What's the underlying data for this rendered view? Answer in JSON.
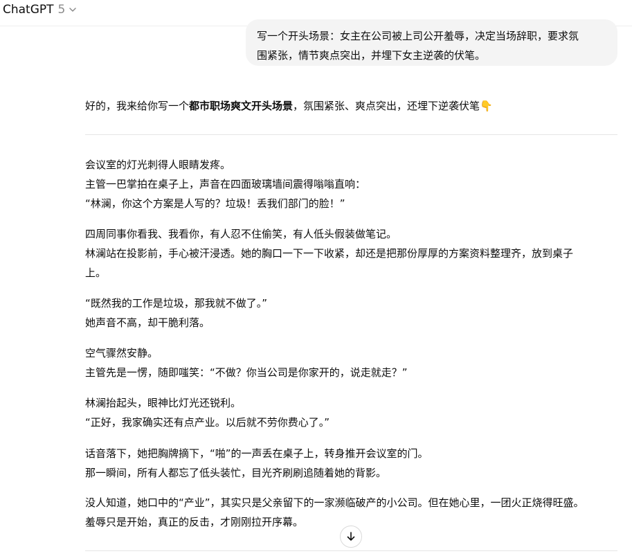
{
  "header": {
    "model_name": "ChatGPT",
    "model_version": "5"
  },
  "user_message": {
    "line1": "写一个开头场景：女主在公司被上司公开羞辱，决定当场辞职，要求氛",
    "line2": "围紧张，情节爽点突出，并埋下女主逆袭的伏笔。"
  },
  "assistant": {
    "intro_prefix": "好的，我来给你写一个",
    "intro_bold": "都市职场爽文开头场景",
    "intro_suffix": "，氛围紧张、爽点突出，还埋下逆袭伏笔👇",
    "paragraphs": [
      [
        "会议室的灯光刺得人眼睛发疼。",
        "主管一巴掌拍在桌子上，声音在四面玻璃墙间震得嗡嗡直响：",
        "“林澜，你这个方案是人写的？垃圾！丢我们部门的脸！”"
      ],
      [
        "四周同事你看我、我看你，有人忍不住偷笑，有人低头假装做笔记。",
        "林澜站在投影前，手心被汗浸透。她的胸口一下一下收紧，却还是把那份厚厚的方案资料整理齐，放到桌子",
        "上。"
      ],
      [
        "“既然我的工作是垃圾，那我就不做了。”",
        "她声音不高，却干脆利落。"
      ],
      [
        "空气骤然安静。",
        "主管先是一愣，随即嗤笑：“不做？你当公司是你家开的，说走就走？”"
      ],
      [
        "林澜抬起头，眼神比灯光还锐利。",
        "“正好，我家确实还有点产业。以后就不劳你费心了。”"
      ],
      [
        "话音落下，她把胸牌摘下，“啪”的一声丢在桌子上，转身推开会议室的门。",
        "那一瞬间，所有人都忘了低头装忙，目光齐刷刷追随着她的背影。"
      ],
      [
        "没人知道，她口中的“产业”，其实只是父亲留下的一家濒临破产的小公司。但在她心里，一团火正烧得旺盛。",
        "羞辱只是开始，真正的反击，才刚刚拉开序幕。"
      ]
    ]
  },
  "icons": {
    "model_dropdown": "chevron-down-icon",
    "scroll_down": "arrow-down-icon"
  },
  "colors": {
    "text": "#0d0d0d",
    "muted": "#8a8a8a",
    "bubble_bg": "#f4f4f4",
    "divider": "#e5e5e5"
  }
}
